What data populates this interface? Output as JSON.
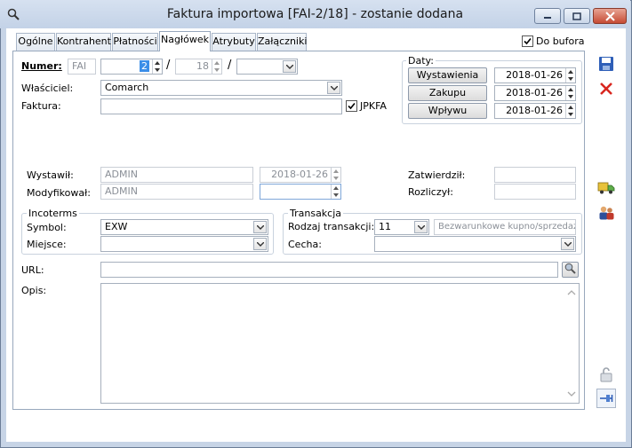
{
  "window": {
    "title": "Faktura importowa [FAI-2/18]  - zostanie dodana"
  },
  "tabs": [
    {
      "label": "Ogólne"
    },
    {
      "label": "Kontrahent"
    },
    {
      "label": "Płatności"
    },
    {
      "label": "Nagłówek"
    },
    {
      "label": "Atrybuty"
    },
    {
      "label": "Załączniki"
    }
  ],
  "do_bufora": {
    "label": "Do bufora",
    "checked": true
  },
  "numer": {
    "label": "Numer:",
    "prefix": "FAI",
    "number": "2",
    "year": "18",
    "separator1": "/",
    "separator2": "/",
    "series": ""
  },
  "wlasciciel": {
    "label": "Właściciel:",
    "value": "Comarch"
  },
  "faktura": {
    "label": "Faktura:",
    "value": "",
    "jpkfa_label": "JPKFA",
    "jpkfa_checked": true
  },
  "daty": {
    "title": "Daty:",
    "wystawienia": {
      "label": "Wystawienia",
      "value": "2018-01-26"
    },
    "zakupu": {
      "label": "Zakupu",
      "value": "2018-01-26"
    },
    "wplywu": {
      "label": "Wpływu",
      "value": "2018-01-26"
    }
  },
  "wystawil": {
    "label": "Wystawił:",
    "value": "ADMIN",
    "date": "2018-01-26"
  },
  "modyfikowal": {
    "label": "Modyfikował:",
    "value": "ADMIN",
    "date": ""
  },
  "zatwierdzil": {
    "label": "Zatwierdził:",
    "value": ""
  },
  "rozliczyl": {
    "label": "Rozliczył:",
    "value": ""
  },
  "incoterms": {
    "title": "Incoterms",
    "symbol_label": "Symbol:",
    "symbol_value": "EXW",
    "miejsce_label": "Miejsce:",
    "miejsce_value": ""
  },
  "transakcja": {
    "title": "Transakcja",
    "rodzaj_label": "Rodzaj transakcji:",
    "rodzaj_value": "11",
    "rodzaj_desc": "Bezwarunkowe kupno/sprzedaż",
    "cecha_label": "Cecha:",
    "cecha_value": ""
  },
  "url": {
    "label": "URL:",
    "value": ""
  },
  "opis": {
    "label": "Opis:",
    "value": ""
  },
  "colors": {
    "accent_blue": "#3b8ee8",
    "close_red": "#c64b34"
  }
}
